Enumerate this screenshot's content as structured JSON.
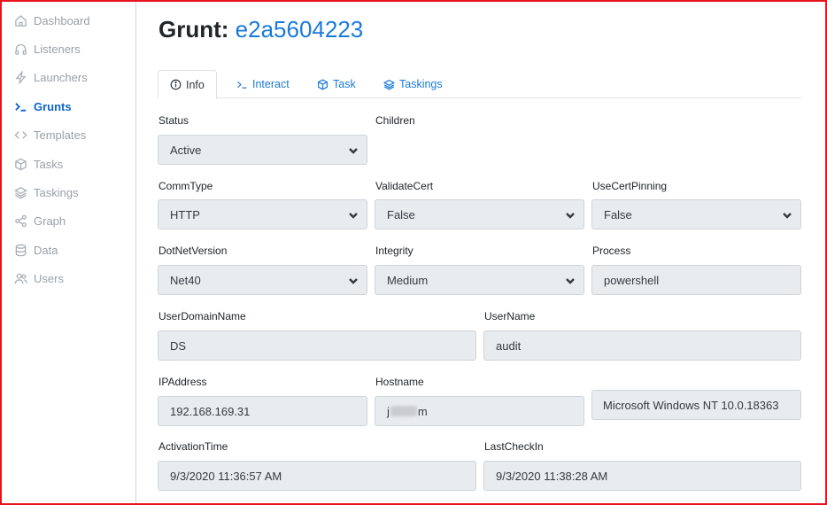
{
  "sidebar": {
    "items": [
      {
        "label": "Dashboard",
        "icon": "home-icon",
        "active": false
      },
      {
        "label": "Listeners",
        "icon": "headphones-icon",
        "active": false
      },
      {
        "label": "Launchers",
        "icon": "lightning-icon",
        "active": false
      },
      {
        "label": "Grunts",
        "icon": "terminal-icon",
        "active": true
      },
      {
        "label": "Templates",
        "icon": "code-icon",
        "active": false
      },
      {
        "label": "Tasks",
        "icon": "box-icon",
        "active": false
      },
      {
        "label": "Taskings",
        "icon": "layers-icon",
        "active": false
      },
      {
        "label": "Graph",
        "icon": "share-icon",
        "active": false
      },
      {
        "label": "Data",
        "icon": "database-icon",
        "active": false
      },
      {
        "label": "Users",
        "icon": "users-icon",
        "active": false
      }
    ]
  },
  "header": {
    "title_prefix": "Grunt:",
    "grunt_id": "e2a5604223"
  },
  "tabs": [
    {
      "label": "Info",
      "icon": "info-icon",
      "active": true
    },
    {
      "label": "Interact",
      "icon": "terminal-icon",
      "active": false
    },
    {
      "label": "Task",
      "icon": "box-icon",
      "active": false
    },
    {
      "label": "Taskings",
      "icon": "layers-icon",
      "active": false
    }
  ],
  "form": {
    "status": {
      "label": "Status",
      "value": "Active"
    },
    "children": {
      "label": "Children"
    },
    "commtype": {
      "label": "CommType",
      "value": "HTTP"
    },
    "validatecert": {
      "label": "ValidateCert",
      "value": "False"
    },
    "usecertpinning": {
      "label": "UseCertPinning",
      "value": "False"
    },
    "dotnetversion": {
      "label": "DotNetVersion",
      "value": "Net40"
    },
    "integrity": {
      "label": "Integrity",
      "value": "Medium"
    },
    "process": {
      "label": "Process",
      "value": "powershell"
    },
    "userdomainname": {
      "label": "UserDomainName",
      "value": "DS"
    },
    "username": {
      "label": "UserName",
      "value": "audit"
    },
    "ipaddress": {
      "label": "IPAddress",
      "value": "192.168.169.31"
    },
    "hostname": {
      "label": "Hostname",
      "value_start": "j",
      "value_end": "m"
    },
    "os": {
      "value": "Microsoft Windows NT 10.0.18363"
    },
    "activationtime": {
      "label": "ActivationTime",
      "value": "9/3/2020 11:36:57 AM"
    },
    "lastcheckin": {
      "label": "LastCheckIn",
      "value": "9/3/2020 11:38:28 AM"
    }
  },
  "colors": {
    "accent": "#1a7ad9",
    "active_nav": "#0b63ce",
    "frame_border": "#e8141c",
    "field_bg": "#e9ecef"
  }
}
